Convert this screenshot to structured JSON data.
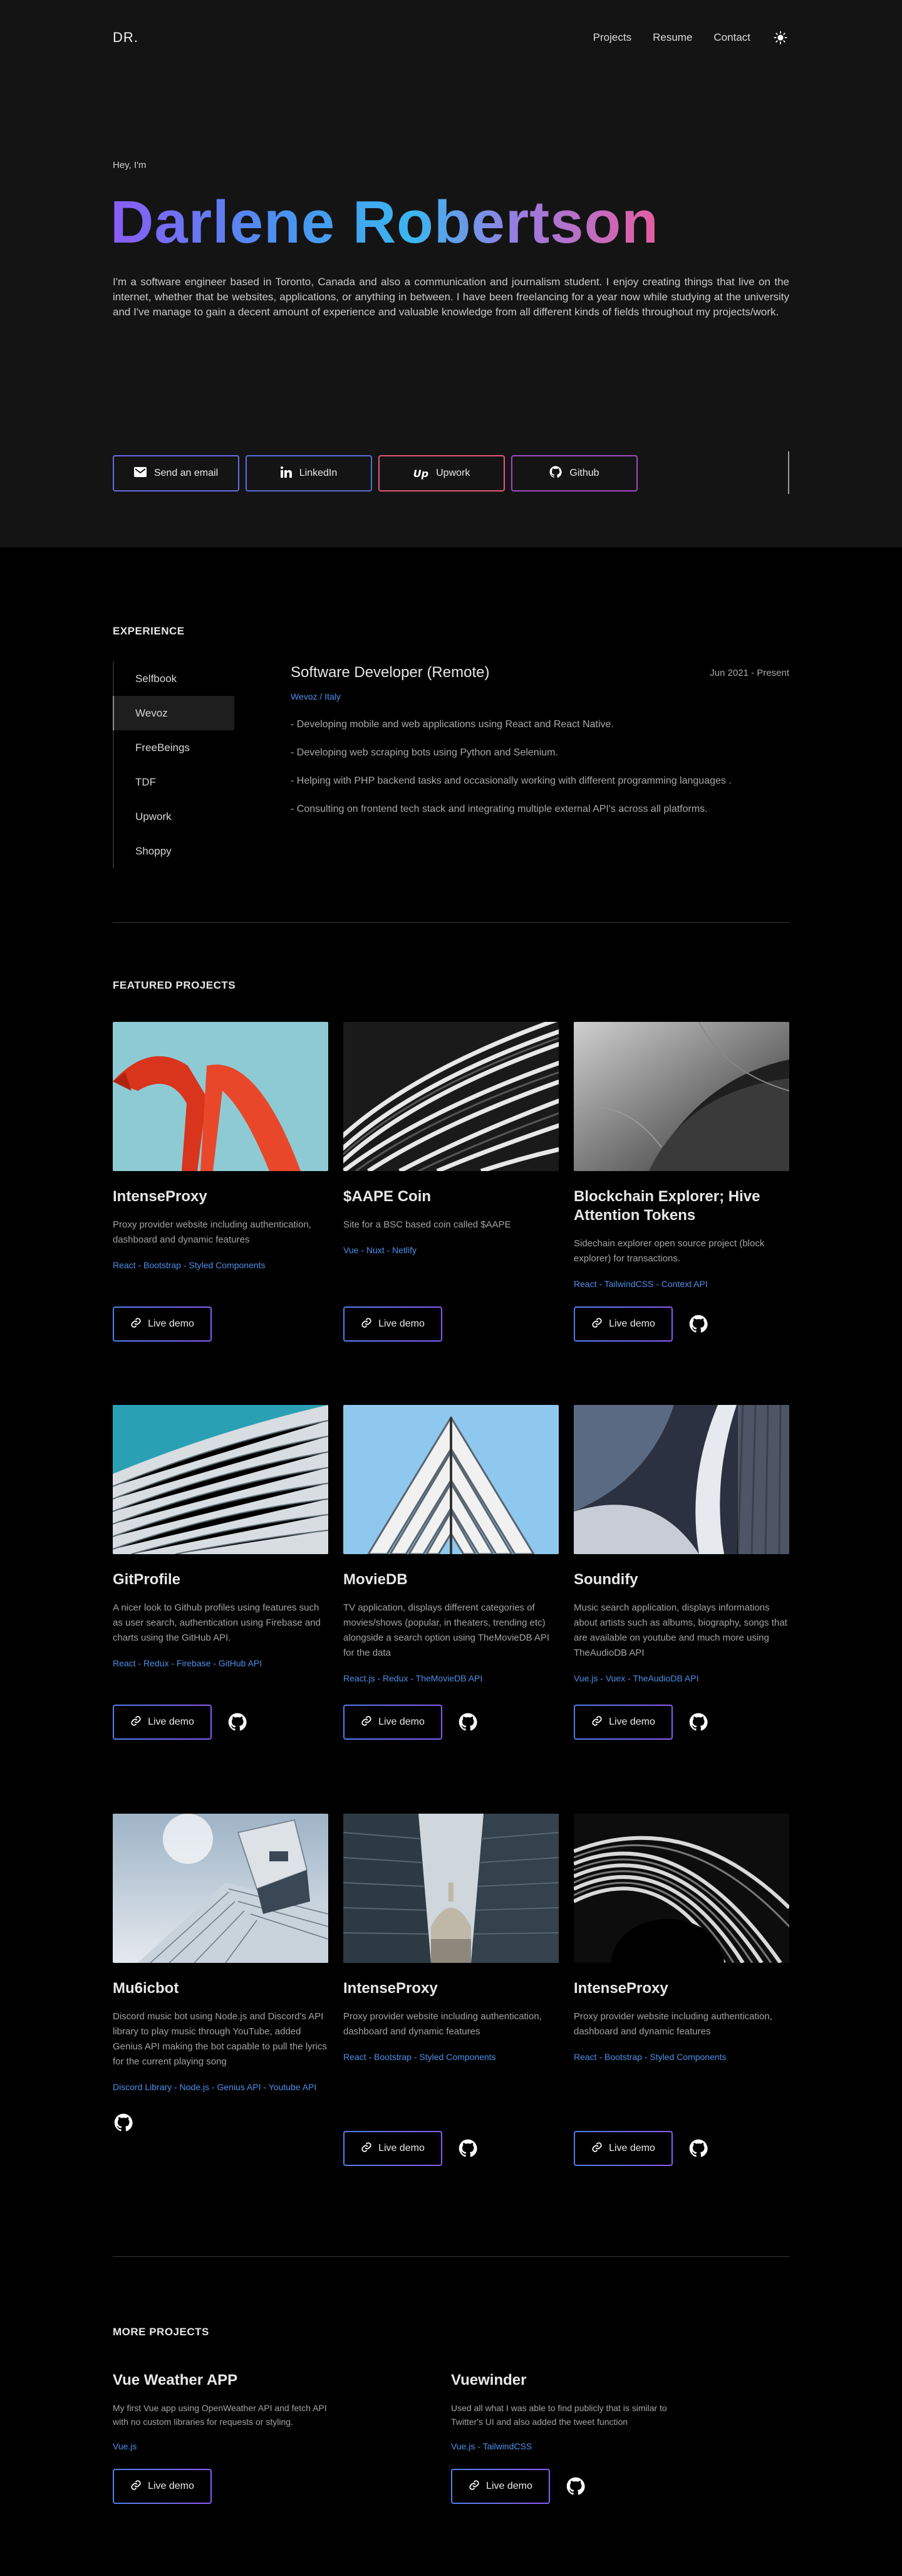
{
  "nav": {
    "logo": "DR.",
    "links": [
      "Projects",
      "Resume",
      "Contact"
    ]
  },
  "hero": {
    "greeting": "Hey, I'm",
    "name": "Darlene Robertson",
    "bio": "I'm a software engineer based in Toronto, Canada and also a communication and journalism student. I enjoy creating things that live on the internet, whether that be websites, applications, or anything in between. I have been freelancing for a year now while studying at the university and I've manage to gain a decent amount of experience and valuable knowledge from all different kinds of fields throughout my projects/work.",
    "buttons": [
      {
        "label": "Send an email",
        "icon": "mail-icon"
      },
      {
        "label": "LinkedIn",
        "icon": "linkedin-icon"
      },
      {
        "label": "Upwork",
        "icon": "upwork-icon"
      },
      {
        "label": "Github",
        "icon": "github-icon"
      }
    ]
  },
  "experience": {
    "title": "EXPERIENCE",
    "tabs": [
      "Selfbook",
      "Wevoz",
      "FreeBeings",
      "TDF",
      "Upwork",
      "Shoppy"
    ],
    "active_tab": "Wevoz",
    "role": "Software Developer (Remote)",
    "date": "Jun 2021 - Present",
    "company": "Wevoz / Italy",
    "bullets": [
      "Developing mobile and web applications using React and React Native.",
      "Developing web scraping bots using Python and Selenium.",
      "Helping with PHP backend tasks and occasionally working with different programming languages .",
      "Consulting on frontend tech stack and integrating multiple external API's across all platforms."
    ]
  },
  "featured": {
    "title": "FEATURED PROJECTS",
    "demo_label": "Live demo",
    "projects": [
      {
        "title": "IntenseProxy",
        "desc": "Proxy provider website including authentication, dashboard and dynamic features",
        "tags": "React - Bootstrap - Styled Components",
        "github": false
      },
      {
        "title": "$AAPE Coin",
        "desc": "Site for a BSC based coin called $AAPE",
        "tags": "Vue - Nuxt - Netlify",
        "github": false
      },
      {
        "title": "Blockchain Explorer; Hive Attention Tokens",
        "desc": "Sidechain explorer open source project (block explorer) for transactions.",
        "tags": "React - TailwindCSS - Context API",
        "github": true
      },
      {
        "title": "GitProfile",
        "desc": "A nicer look to Github profiles using features such as user search, authentication using Firebase and charts using the GitHub API.",
        "tags": "React - Redux - Firebase - GitHub API",
        "github": true
      },
      {
        "title": "MovieDB",
        "desc": "TV application, displays different categories of movies/shows (popular, in theaters, trending etc) alongside a search option using TheMovieDB API for the data",
        "tags": "React.js - Redux - TheMovieDB API",
        "github": true
      },
      {
        "title": "Soundify",
        "desc": "Music search application, displays informations about artists such as albums, biography, songs that are available on youtube and much more using TheAudioDB API",
        "tags": "Vue.js - Vuex - TheAudioDB API",
        "github": true
      },
      {
        "title": "Mu6icbot",
        "desc": "Discord music bot using Node.js and Discord's API library to play music through YouTube, added Genius API making the bot capable to pull the lyrics for the current playing song",
        "tags": "Discord Library - Node.js - Genius API - Youtube API",
        "github": true,
        "no_demo": true
      },
      {
        "title": "IntenseProxy",
        "desc": "Proxy provider website including authentication, dashboard and dynamic features",
        "tags": "React - Bootstrap - Styled Components",
        "github": true
      },
      {
        "title": "IntenseProxy",
        "desc": "Proxy provider website including authentication, dashboard and dynamic features",
        "tags": "React - Bootstrap - Styled Components",
        "github": true
      }
    ]
  },
  "more": {
    "title": "MORE PROJECTS",
    "projects": [
      {
        "title": "Vue Weather APP",
        "desc": "My first Vue app using OpenWeather API and fetch API with no custom libraries for requests or styling.",
        "tags": "Vue.js",
        "github": false
      },
      {
        "title": "Vuewinder",
        "desc": "Used all what I was able to find publicly that is similar to Twitter's UI and also added the tweet function",
        "tags": "Vue.js - TailwindCSS",
        "github": true
      }
    ]
  },
  "colors": {
    "accent": "#4f8ee8",
    "hero_bg": "#141414",
    "page_bg": "#000000"
  }
}
